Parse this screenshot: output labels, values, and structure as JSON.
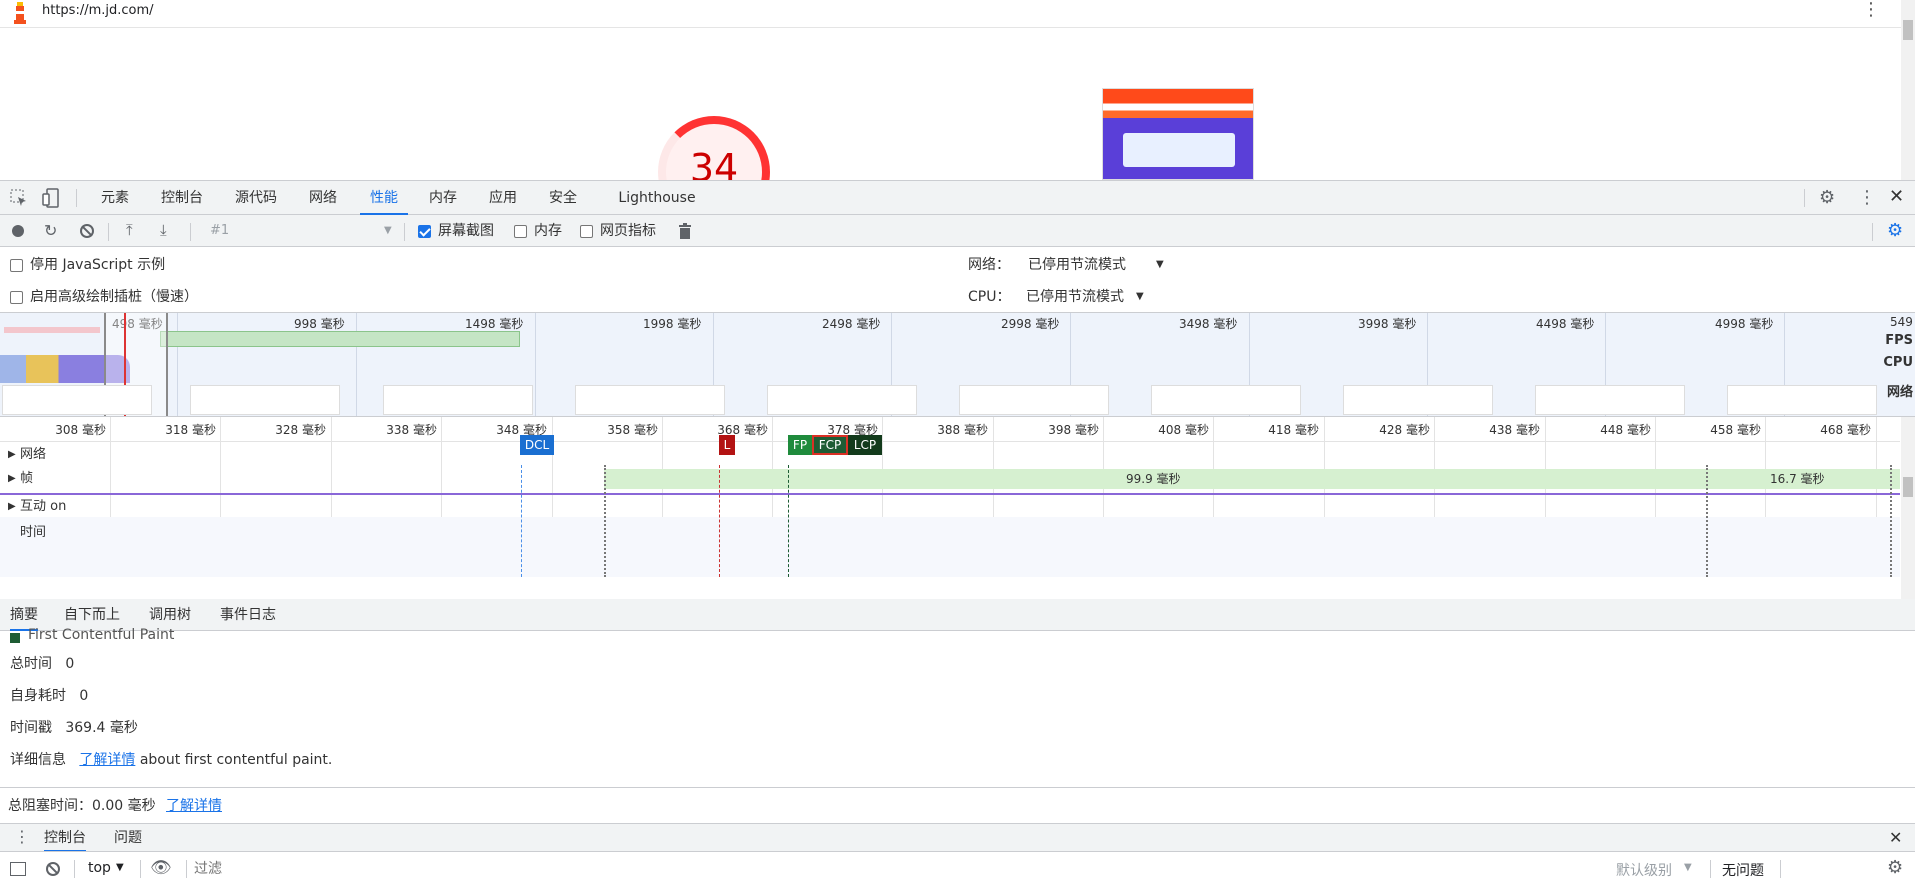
{
  "browser": {
    "url": "https://m.jd.com/",
    "score": "34"
  },
  "devtools": {
    "tabs": [
      "元素",
      "控制台",
      "源代码",
      "网络",
      "性能",
      "内存",
      "应用",
      "安全",
      "Lighthouse"
    ],
    "active_tab": "性能",
    "toolbar": {
      "recording_select": "#1",
      "screenshots_label": "屏幕截图",
      "memory_label": "内存",
      "webvitals_label": "网页指标"
    },
    "settings": {
      "disable_js_label": "停用 JavaScript 示例",
      "advanced_paint_label": "启用高级绘制插桩（慢速）",
      "network_label": "网络：",
      "network_value": "已停用节流模式",
      "cpu_label": "CPU：",
      "cpu_value": "已停用节流模式"
    },
    "overview": {
      "ticks": [
        "498 毫秒",
        "998 毫秒",
        "1498 毫秒",
        "1998 毫秒",
        "2498 毫秒",
        "2998 毫秒",
        "3498 毫秒",
        "3998 毫秒",
        "4498 毫秒",
        "4998 毫秒",
        "549"
      ],
      "labels": {
        "fps": "FPS",
        "cpu": "CPU",
        "net": "网络"
      }
    },
    "timeline": {
      "ticks": [
        "308 毫秒",
        "318 毫秒",
        "328 毫秒",
        "338 毫秒",
        "348 毫秒",
        "358 毫秒",
        "368 毫秒",
        "378 毫秒",
        "388 毫秒",
        "398 毫秒",
        "408 毫秒",
        "418 毫秒",
        "428 毫秒",
        "438 毫秒",
        "448 毫秒",
        "458 毫秒",
        "468 毫秒"
      ],
      "rows": {
        "network": "网络",
        "frames": "帧",
        "interactions": "互动 on",
        "timings": "时间"
      },
      "frame_labels": [
        "99.9 毫秒",
        "16.7 毫秒"
      ],
      "markers": [
        "DCL",
        "L",
        "FP",
        "FCP",
        "LCP"
      ]
    },
    "bottom_tabs": [
      "摘要",
      "自下而上",
      "调用树",
      "事件日志"
    ],
    "summary": {
      "title": "First Contentful Paint",
      "total_time_label": "总时间",
      "total_time": "0",
      "self_time_label": "自身耗时",
      "self_time": "0",
      "timestamp_label": "时间戳",
      "timestamp": "369.4 毫秒",
      "details_label": "详细信息",
      "details_link": "了解详情",
      "details_text": "about first contentful paint."
    },
    "blocking": {
      "label": "总阻塞时间：0.00 毫秒",
      "link": "了解详情"
    },
    "drawer": {
      "tabs": [
        "控制台",
        "问题"
      ]
    },
    "console": {
      "context": "top",
      "filter_placeholder": "过滤",
      "levels": "默认级别",
      "issues": "无问题"
    }
  }
}
